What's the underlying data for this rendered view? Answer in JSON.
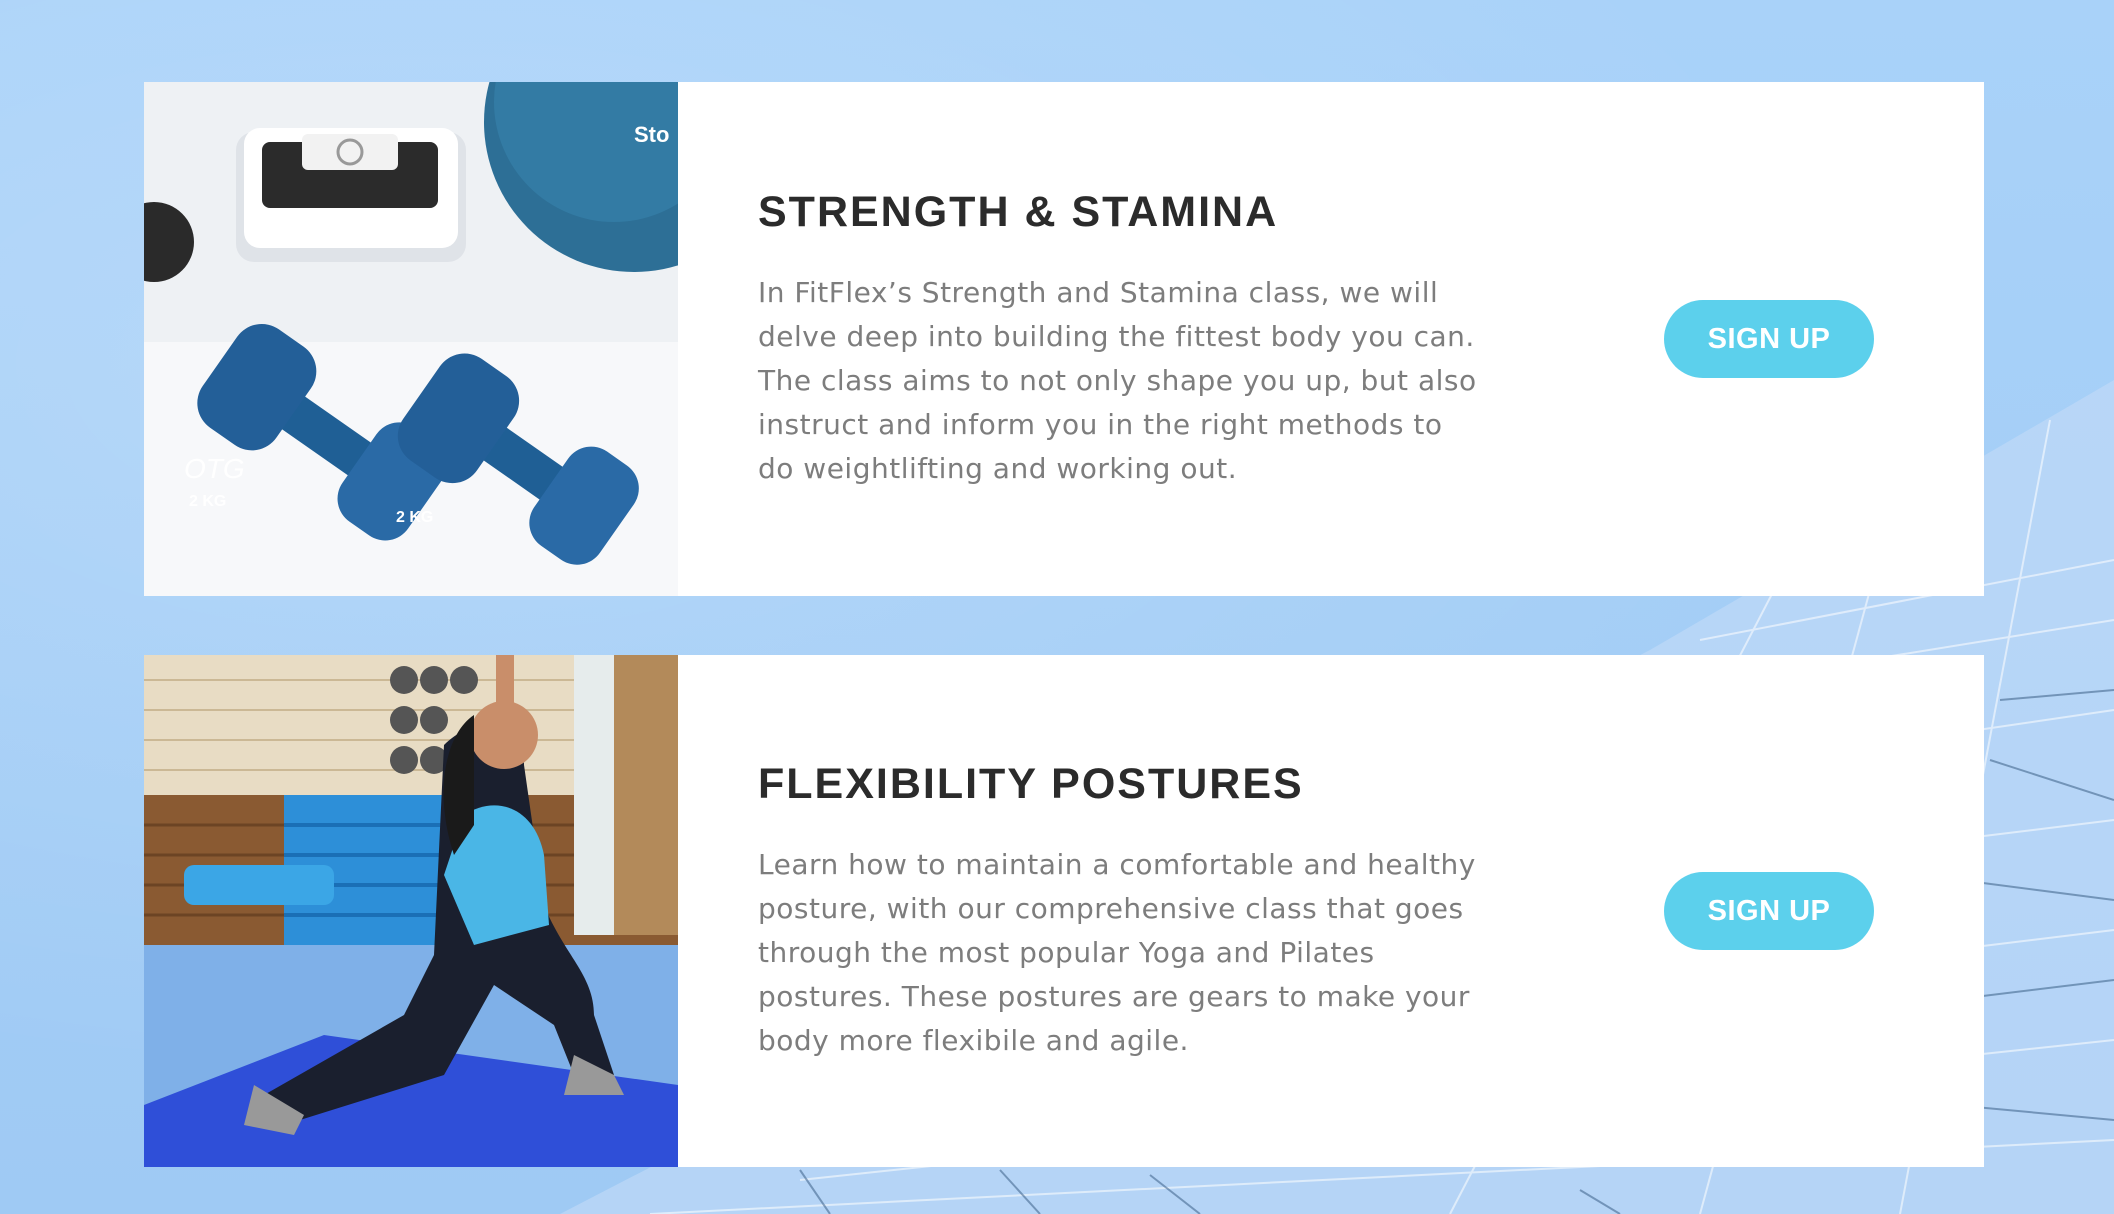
{
  "classes": [
    {
      "title": "STRENGTH & STAMINA",
      "description": "In FitFlex’s Strength and Stamina class, we will delve deep into building the fittest body you can. The class aims to not only shape you up, but also instruct and inform you in the right methods to do weightlifting and working out.",
      "button_label": "SIGN UP",
      "image_labels": {
        "dumbbell_weight": "2 KG",
        "dumbbell_brand": "OTG",
        "ball_text": "Sto"
      }
    },
    {
      "title": "FLEXIBILITY POSTURES",
      "description": "Learn how to maintain a comfortable and healthy posture, with our comprehensive class that goes through the most popular Yoga and Pilates postures. These postures are gears to make your body more flexibile and agile.",
      "button_label": "SIGN UP"
    }
  ],
  "colors": {
    "background": "#a6d0f8",
    "button": "#5cd0ec",
    "title": "#2b2b2b",
    "text": "#7d7d7d"
  }
}
